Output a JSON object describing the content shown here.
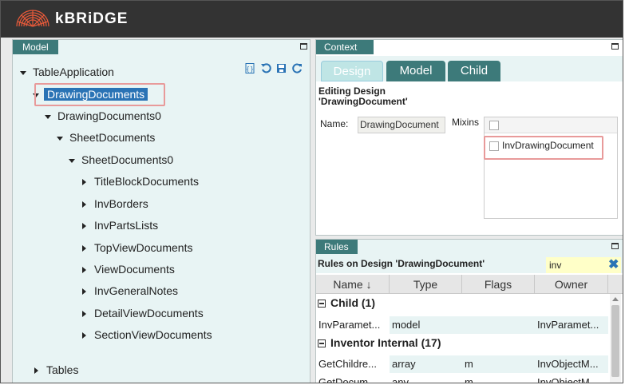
{
  "app": {
    "brand": "kBRiDGE"
  },
  "model_panel": {
    "title": "Model",
    "tree": [
      {
        "label": "TableApplication"
      },
      {
        "label": "DrawingDocuments"
      },
      {
        "label": "DrawingDocuments0"
      },
      {
        "label": "SheetDocuments"
      },
      {
        "label": "SheetDocuments0"
      },
      {
        "label": "TitleBlockDocuments"
      },
      {
        "label": "InvBorders"
      },
      {
        "label": "InvPartsLists"
      },
      {
        "label": "TopViewDocuments"
      },
      {
        "label": "ViewDocuments"
      },
      {
        "label": "InvGeneralNotes"
      },
      {
        "label": "DetailViewDocuments"
      },
      {
        "label": "SectionViewDocuments"
      },
      {
        "label": "Tables"
      }
    ]
  },
  "context_panel": {
    "title": "Context",
    "tabs": [
      "Design",
      "Model",
      "Child"
    ],
    "editing_title_line1": "Editing Design",
    "editing_title_line2": "'DrawingDocument'",
    "name_label": "Name:",
    "name_value": "DrawingDocument",
    "mixins_label": "Mixins",
    "mixins": [
      "InvDrawingDocument"
    ]
  },
  "rules_panel": {
    "title": "Rules",
    "heading": "Rules on Design 'DrawingDocument'",
    "filter_value": "inv",
    "columns": [
      "Name",
      "Type",
      "Flags",
      "Owner"
    ],
    "groups": [
      {
        "label": "Child",
        "count": "(1)",
        "rows": [
          [
            "InvParamet...",
            "model",
            "",
            "InvParamet..."
          ]
        ]
      },
      {
        "label": "Inventor Internal",
        "count": "(17)",
        "rows": [
          [
            "GetChildre...",
            "array",
            "m",
            "InvObjectM..."
          ],
          [
            "GetDocum...",
            "any",
            "m",
            "InvObjectM..."
          ]
        ]
      }
    ]
  },
  "colors": {
    "accent": "#3d7a7a",
    "selection": "#2a73b5",
    "highlight": "#e89a9a"
  }
}
